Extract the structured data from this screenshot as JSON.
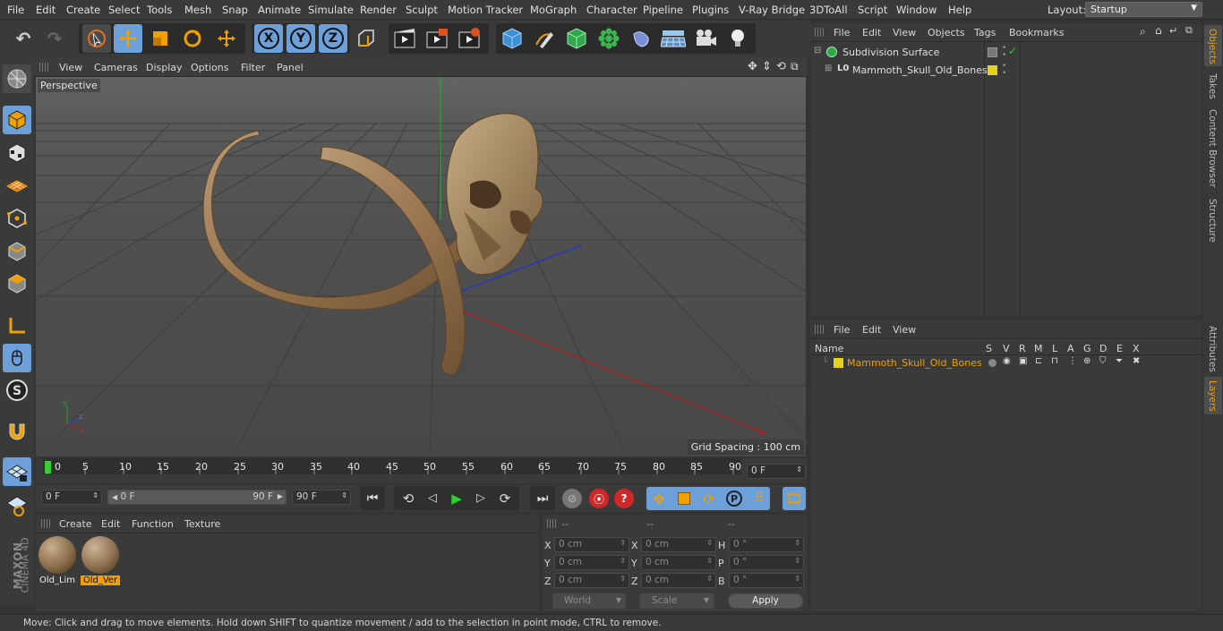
{
  "menubar": {
    "items": [
      "File",
      "Edit",
      "Create",
      "Select",
      "Tools",
      "Mesh",
      "Snap",
      "Animate",
      "Simulate",
      "Render",
      "Sculpt",
      "Motion Tracker",
      "MoGraph",
      "Character",
      "Pipeline",
      "Plugins",
      "V-Ray Bridge",
      "3DToAll",
      "Script",
      "Window",
      "Help"
    ],
    "layout_label": "Layout:",
    "layout_value": "Startup"
  },
  "toolbar": {
    "axis_x": "X",
    "axis_y": "Y",
    "axis_z": "Z"
  },
  "viewport": {
    "menu": [
      "View",
      "Cameras",
      "Display",
      "Options",
      "Filter",
      "Panel"
    ],
    "camera_label": "Perspective",
    "grid_spacing": "Grid Spacing : 100 cm"
  },
  "timeline": {
    "ticks": [
      "0",
      "5",
      "10",
      "15",
      "20",
      "25",
      "30",
      "35",
      "40",
      "45",
      "50",
      "55",
      "60",
      "65",
      "70",
      "75",
      "80",
      "85",
      "90"
    ],
    "current_frame": "0 F",
    "start_field": "0 F",
    "range_start": "0 F",
    "range_end": "90 F",
    "end_field": "90 F"
  },
  "materials": {
    "menu": [
      "Create",
      "Edit",
      "Function",
      "Texture"
    ],
    "items": [
      {
        "label": "Old_Lim",
        "selected": false
      },
      {
        "label": "Old_Ver",
        "selected": true
      }
    ]
  },
  "attributes": {
    "headers": [
      "--",
      "--",
      "--"
    ],
    "rows": [
      {
        "a": "X",
        "av": "0 cm",
        "b": "X",
        "bv": "0 cm",
        "c": "H",
        "cv": "0 °"
      },
      {
        "a": "Y",
        "av": "0 cm",
        "b": "Y",
        "bv": "0 cm",
        "c": "P",
        "cv": "0 °"
      },
      {
        "a": "Z",
        "av": "0 cm",
        "b": "Z",
        "bv": "0 cm",
        "c": "B",
        "cv": "0 °"
      }
    ],
    "coord_mode": "World",
    "scale_mode": "Scale",
    "apply": "Apply"
  },
  "objects": {
    "menu": [
      "File",
      "Edit",
      "View",
      "Objects",
      "Tags",
      "Bookmarks"
    ],
    "tree": [
      {
        "name": "Subdivision Surface"
      },
      {
        "name": "Mammoth_Skull_Old_Bones"
      }
    ]
  },
  "layers": {
    "menu": [
      "File",
      "Edit",
      "View"
    ],
    "columns": [
      "Name",
      "S",
      "V",
      "R",
      "M",
      "L",
      "A",
      "G",
      "D",
      "E",
      "X"
    ],
    "rows": [
      {
        "name": "Mammoth_Skull_Old_Bones",
        "color": "#e6d21e"
      }
    ]
  },
  "side_tabs": [
    "Objects",
    "Takes",
    "Content Browser",
    "Structure",
    "Attributes",
    "Layers"
  ],
  "branding": {
    "line1": "MAXON",
    "line2": "CINEMA 4D"
  },
  "status": "Move: Click and drag to move elements. Hold down SHIFT to quantize movement / add to the selection in point mode, CTRL to remove.",
  "colors": {
    "accent": "#f0a000",
    "selection_blue": "#6d9fd8",
    "layer_yellow": "#e6d21e"
  }
}
